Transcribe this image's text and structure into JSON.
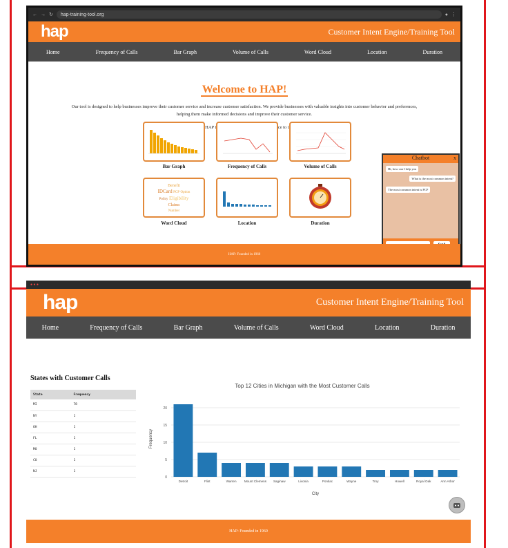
{
  "top_window": {
    "url": "hap-training-tool.org",
    "logo": "hap",
    "tool_title": "Customer Intent Engine/Training Tool",
    "nav": [
      "Home",
      "Frequency of Calls",
      "Bar Graph",
      "Volume of Calls",
      "Word Cloud",
      "Location",
      "Duration"
    ],
    "welcome": "Welcome to HAP!",
    "intro": "Our tool is designed to help businesses improve their customer service and increase customer satisfaction. We provide businesses with valuable insights into customer behavior and preferences, helping them make informed decisions and improve their customer service.",
    "cta": "Get started with HAP today and take your customer service to the next level!",
    "cards": [
      "Bar Graph",
      "Frequency of Calls",
      "Volume of Calls",
      "Word Cloud",
      "Location",
      "Duration"
    ],
    "word_cloud_words": [
      "Benefit",
      "IDCard",
      "PCP",
      "Option",
      "Policy",
      "Eligibility",
      "Claims",
      "Number"
    ],
    "chatbot": {
      "title": "Chatbot",
      "close": "x",
      "messages": [
        "Hi, how can I help you",
        "What is the most common intent?",
        "The most common intent is PCP"
      ],
      "input_placeholder": "Type a message...",
      "send": "Send"
    },
    "footer": "HAP: Founded in 1960"
  },
  "bottom_window": {
    "logo": "hap",
    "tool_title": "Customer Intent Engine/Training Tool",
    "nav": [
      "Home",
      "Frequency of Calls",
      "Bar Graph",
      "Volume of Calls",
      "Word Cloud",
      "Location",
      "Duration"
    ],
    "states_title": "States with Customer Calls",
    "table": {
      "headers": [
        "State",
        "Frequency"
      ],
      "rows": [
        [
          "MI",
          "78"
        ],
        [
          "NY",
          "1"
        ],
        [
          "OH",
          "1"
        ],
        [
          "FL",
          "1"
        ],
        [
          "MO",
          "1"
        ],
        [
          "CO",
          "1"
        ],
        [
          "NJ",
          "1"
        ]
      ]
    },
    "footer": "HAP: Founded in 1960"
  },
  "chart_data": {
    "type": "bar",
    "title": "Top 12 Cities in Michigan with the Most Customer Calls",
    "xlabel": "City",
    "ylabel": "Frequency",
    "categories": [
      "Detroit",
      "Flint",
      "Warren",
      "Mount Clemens",
      "Saginaw",
      "Livonia",
      "Pontiac",
      "Wayne",
      "Troy",
      "Howell",
      "Royal Oak",
      "Ann Arbor"
    ],
    "values": [
      21,
      7,
      4,
      4,
      4,
      3,
      3,
      3,
      2,
      2,
      2,
      2
    ],
    "ylim": [
      0,
      22
    ],
    "yticks": [
      0,
      5,
      10,
      15,
      20
    ],
    "grid": true,
    "bar_color": "#2277b4"
  },
  "colors": {
    "brand_orange": "#f4802a",
    "nav_gray": "#4b4b4b",
    "frame_red": "#e0161b"
  }
}
